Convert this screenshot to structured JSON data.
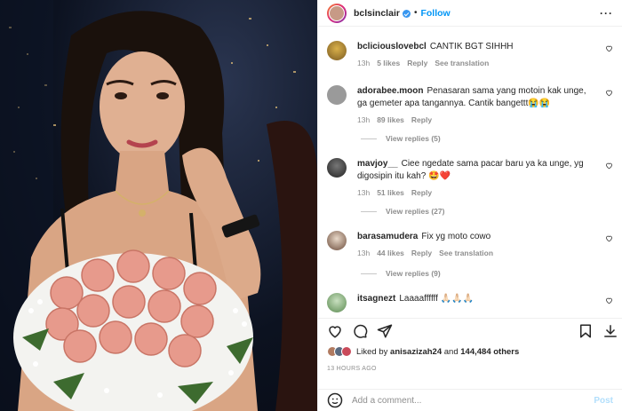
{
  "post_author": {
    "username": "bclsinclair",
    "follow_label": "Follow",
    "dot": "•",
    "more": "···"
  },
  "comments": [
    {
      "username": "bclicious‌lovebcl",
      "text": "CANTIK BGT SIHHH",
      "time": "13h",
      "likes": "5 likes",
      "reply": "Reply",
      "translate": "See translation",
      "replies": ""
    },
    {
      "username": "adorabee.moon",
      "text": "Penasaran sama yang motoin kak unge, ga gemeter apa tangannya. Cantik bangettt😭😭",
      "time": "13h",
      "likes": "89 likes",
      "reply": "Reply",
      "translate": "",
      "replies": "View replies (5)"
    },
    {
      "username": "mavjoy__",
      "text": "Ciee ngedate sama pacar baru ya ka unge, yg digosipin itu kah? 🤩❤️",
      "time": "13h",
      "likes": "51 likes",
      "reply": "Reply",
      "translate": "",
      "replies": "View replies (27)"
    },
    {
      "username": "barasamudera",
      "text": "Fix yg moto cowo",
      "time": "13h",
      "likes": "44 likes",
      "reply": "Reply",
      "translate": "See translation",
      "replies": "View replies (9)"
    },
    {
      "username": "itsagnezt",
      "text": "Laaaaffffff 🙏🏻🙏🏻🙏🏻",
      "time": "",
      "likes": "",
      "reply": "",
      "translate": "",
      "replies": ""
    }
  ],
  "likes_line": {
    "prefix": "Liked by",
    "user": "anisazizah24",
    "and": "and",
    "count": "144,484 others"
  },
  "timestamp": "13 HOURS AGO",
  "add_comment": {
    "placeholder": "Add a comment...",
    "post_label": "Post"
  },
  "colors": {
    "accent": "#0095f6",
    "verified": "#3897f0",
    "muted": "#8e8e8e"
  }
}
